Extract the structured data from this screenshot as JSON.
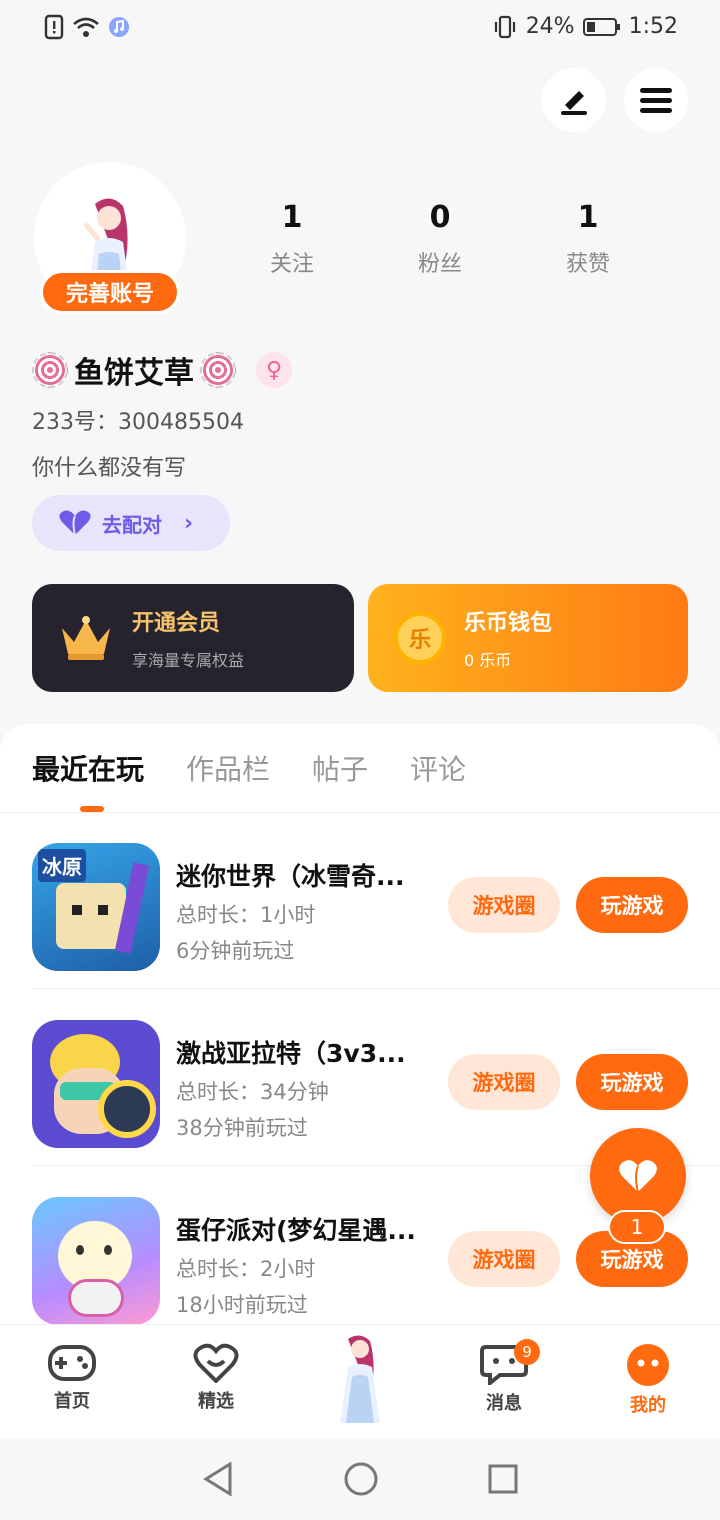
{
  "status_bar": {
    "battery": "24%",
    "time": "1:52"
  },
  "profile": {
    "complete_label": "完善账号",
    "stats": [
      {
        "value": "1",
        "label": "关注"
      },
      {
        "value": "0",
        "label": "粉丝"
      },
      {
        "value": "1",
        "label": "获赞"
      }
    ],
    "nickname": "鱼饼艾草",
    "uid": "233号：300485504",
    "bio": "你什么都没有写",
    "match_label": "去配对"
  },
  "cards": {
    "vip": {
      "title": "开通会员",
      "subtitle": "享海量专属权益"
    },
    "wallet": {
      "title": "乐币钱包",
      "subtitle": "0 乐币",
      "coin_char": "乐"
    }
  },
  "tabs": [
    "最近在玩",
    "作品栏",
    "帖子",
    "评论"
  ],
  "games": [
    {
      "name": "迷你世界（冰雪奇...",
      "duration": "总时长：1小时",
      "last_played": "6分钟前玩过",
      "icon_text": "冰原"
    },
    {
      "name": "激战亚拉特（3v3...",
      "duration": "总时长：34分钟",
      "last_played": "38分钟前玩过"
    },
    {
      "name": "蛋仔派对(梦幻星遇...",
      "duration": "总时长：2小时",
      "last_played": "18小时前玩过"
    }
  ],
  "game_buttons": {
    "circle": "游戏圈",
    "play": "玩游戏"
  },
  "fab": {
    "count": "1"
  },
  "bottom_nav": [
    {
      "label": "首页",
      "icon": "gamepad-icon"
    },
    {
      "label": "精选",
      "icon": "heart-chat-icon"
    },
    {
      "label": "",
      "icon": "avatar-center"
    },
    {
      "label": "消息",
      "icon": "message-icon",
      "badge": "9"
    },
    {
      "label": "我的",
      "icon": "profile-face-icon"
    }
  ],
  "colors": {
    "accent": "#ff6a10",
    "vip_bg": "#26222e",
    "match_bg": "#e7e4fb"
  }
}
